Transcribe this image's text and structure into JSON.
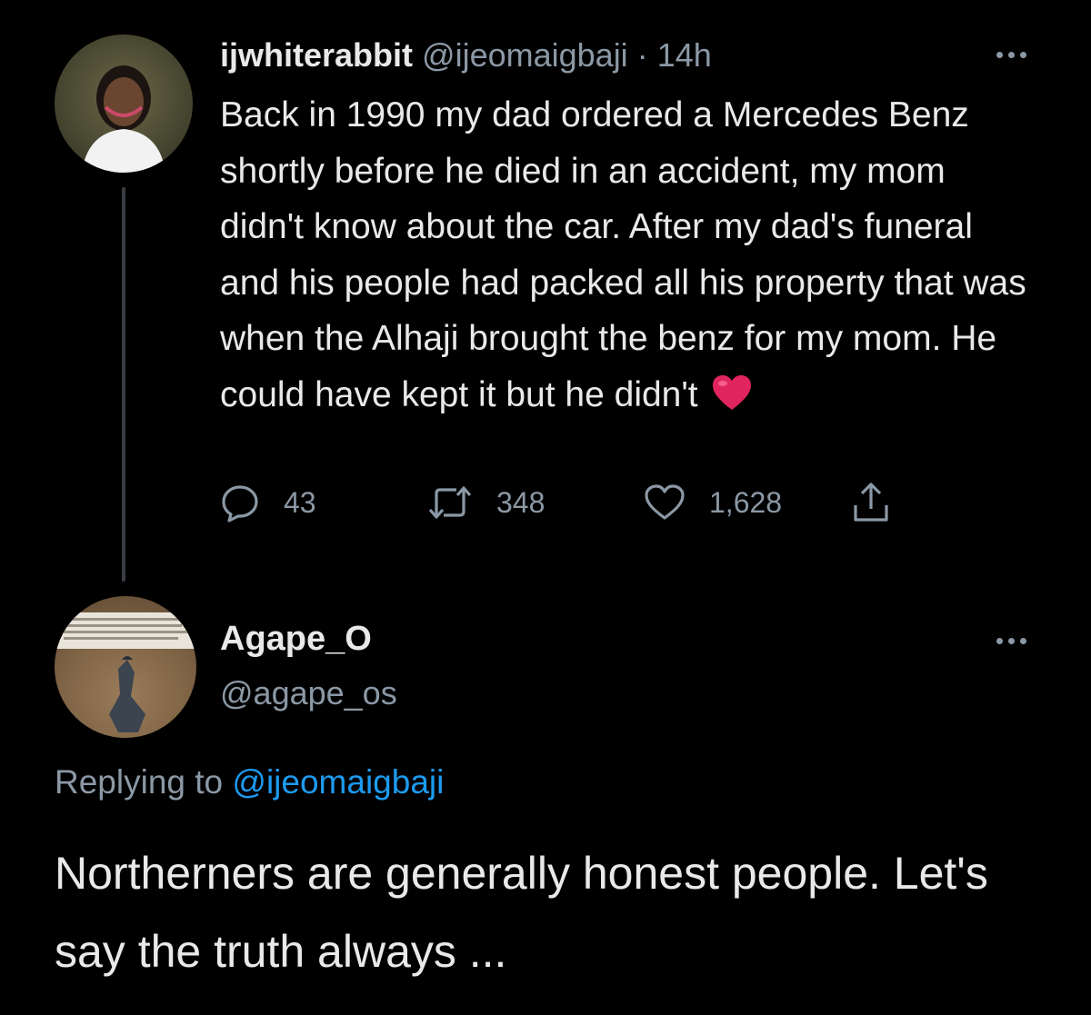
{
  "tweet1": {
    "display_name": "ijwhiterabbit",
    "handle": "@ijeomaigbaji",
    "separator": "·",
    "time": "14h",
    "text": "Back in 1990 my dad ordered a Mercedes Benz shortly before he died in an accident, my mom didn't know about the car. After my dad's funeral and his people had packed all his property that was when the Alhaji brought the benz for my mom. He could have kept it but he didn't",
    "emoji": "red-heart",
    "actions": {
      "reply_count": "43",
      "retweet_count": "348",
      "like_count": "1,628"
    },
    "avatar_icon": "profile-photo",
    "more_icon": "more-icon"
  },
  "tweet2": {
    "display_name": "Agape_O",
    "handle": "@agape_os",
    "replying_prefix": "Replying to",
    "replying_handle": "@ijeomaigbaji",
    "text": "Northerners are generally honest people. Let's say the truth always ...",
    "avatar_icon": "profile-photo",
    "more_icon": "more-icon"
  },
  "colors": {
    "background": "#000000",
    "text": "#e7e9ea",
    "muted": "#8b98a5",
    "link": "#1d9bf0",
    "heart": "#e0245e"
  }
}
